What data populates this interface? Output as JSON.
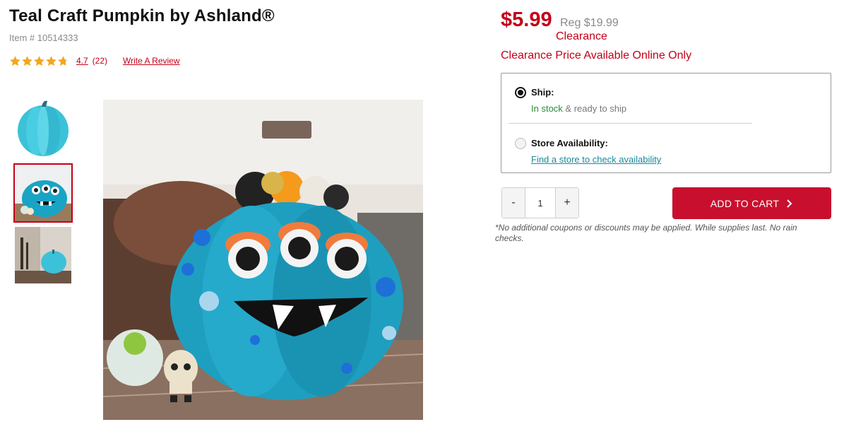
{
  "product": {
    "title": "Teal Craft Pumpkin by Ashland®",
    "item_number": "Item # 10514333",
    "rating": "4.7",
    "rating_value": 4.7,
    "review_count": "(22)",
    "write_review": "Write A Review"
  },
  "pricing": {
    "price": "$5.99",
    "regular": "Reg $19.99",
    "clearance_label": "Clearance",
    "clearance_note": "Clearance Price Available Online Only"
  },
  "fulfillment": {
    "ship_label": "Ship:",
    "ship_status": "In stock",
    "ship_detail": "& ready to ship",
    "store_label": "Store Availability:",
    "store_link": "Find a store to check availability",
    "selected": "ship"
  },
  "purchase": {
    "qty_minus": "-",
    "qty_value": "1",
    "qty_plus": "+",
    "add_to_cart": "ADD TO CART",
    "disclaimer": "*No additional coupons or discounts may be applied. While supplies last. No rain checks."
  },
  "gallery": {
    "selected_index": 1
  },
  "colors": {
    "brand_red": "#c4001a",
    "button_red": "#c8102e",
    "in_stock_green": "#2e8b3a",
    "link_teal": "#1a8a9a",
    "star_gold": "#f2a81d"
  }
}
